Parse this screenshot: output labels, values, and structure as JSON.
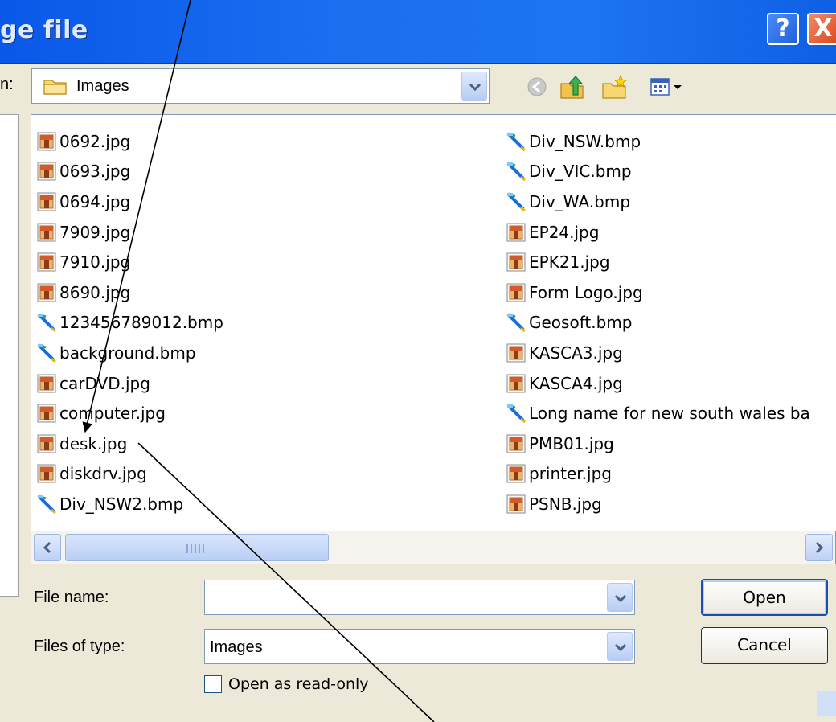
{
  "window": {
    "title": "ge file",
    "help_label": "?",
    "close_label": "X"
  },
  "lookin": {
    "label": "n:",
    "value": "Images"
  },
  "files": {
    "left": [
      {
        "name": "0692.jpg",
        "type": "jpg"
      },
      {
        "name": "0693.jpg",
        "type": "jpg"
      },
      {
        "name": "0694.jpg",
        "type": "jpg"
      },
      {
        "name": "7909.jpg",
        "type": "jpg"
      },
      {
        "name": "7910.jpg",
        "type": "jpg"
      },
      {
        "name": "8690.jpg",
        "type": "jpg"
      },
      {
        "name": "123456789012.bmp",
        "type": "bmp"
      },
      {
        "name": "background.bmp",
        "type": "bmp"
      },
      {
        "name": "carDVD.jpg",
        "type": "jpg"
      },
      {
        "name": "computer.jpg",
        "type": "jpg"
      },
      {
        "name": "desk.jpg",
        "type": "jpg"
      },
      {
        "name": "diskdrv.jpg",
        "type": "jpg"
      },
      {
        "name": "Div_NSW2.bmp",
        "type": "bmp"
      }
    ],
    "right": [
      {
        "name": "Div_NSW.bmp",
        "type": "bmp"
      },
      {
        "name": "Div_VIC.bmp",
        "type": "bmp"
      },
      {
        "name": "Div_WA.bmp",
        "type": "bmp"
      },
      {
        "name": "EP24.jpg",
        "type": "jpg"
      },
      {
        "name": "EPK21.jpg",
        "type": "jpg"
      },
      {
        "name": "Form Logo.jpg",
        "type": "jpg"
      },
      {
        "name": "Geosoft.bmp",
        "type": "bmp"
      },
      {
        "name": "KASCA3.jpg",
        "type": "jpg"
      },
      {
        "name": "KASCA4.jpg",
        "type": "jpg"
      },
      {
        "name": "Long name for new south wales ba",
        "type": "bmp"
      },
      {
        "name": "PMB01.jpg",
        "type": "jpg"
      },
      {
        "name": "printer.jpg",
        "type": "jpg"
      },
      {
        "name": "PSNB.jpg",
        "type": "jpg"
      }
    ]
  },
  "form": {
    "filename_label": "File name:",
    "filename_value": "",
    "filetype_label": "Files of type:",
    "filetype_value": "Images",
    "readonly_label": "Open as read-only",
    "readonly_checked": false
  },
  "buttons": {
    "open": "Open",
    "cancel": "Cancel"
  },
  "icons": {
    "folder": "folder-icon",
    "back": "back-arrow-icon",
    "up": "up-folder-icon",
    "new_folder": "new-folder-icon",
    "views": "views-menu-icon",
    "jpg": "jpg-file-icon",
    "bmp": "bmp-file-icon"
  },
  "colors": {
    "title_bar": "#1b6ef0",
    "dialog_bg": "#ece9d8",
    "close_button": "#d94a1e",
    "accent_border": "#7f9db9"
  }
}
